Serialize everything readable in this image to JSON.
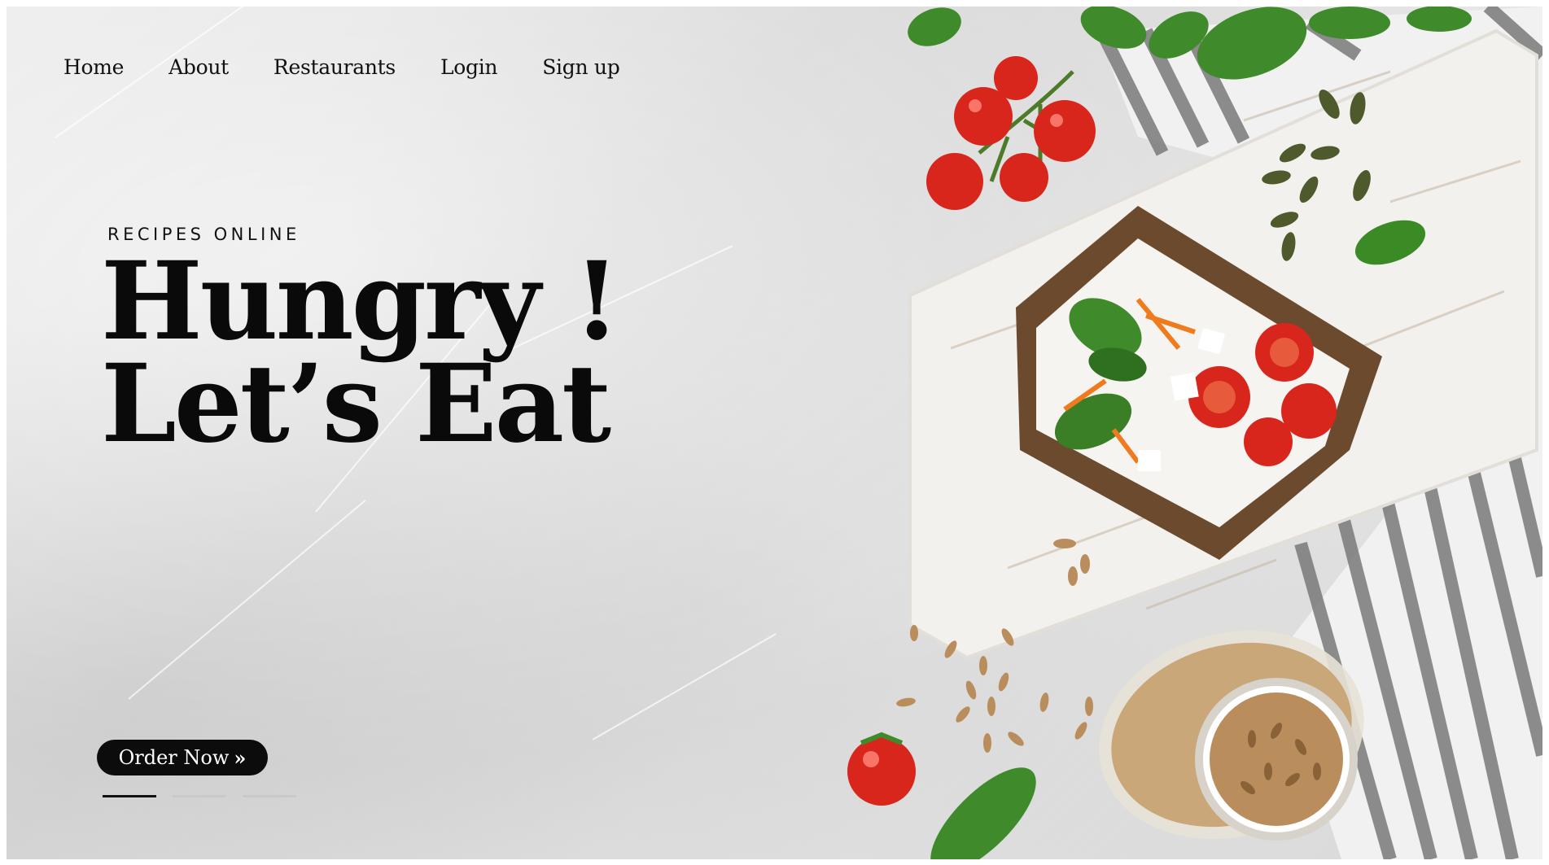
{
  "nav": {
    "items": [
      {
        "label": "Home"
      },
      {
        "label": "About"
      },
      {
        "label": "Restaurants"
      },
      {
        "label": "Login"
      },
      {
        "label": "Sign up"
      }
    ]
  },
  "hero": {
    "eyebrow": "RECIPES ONLINE",
    "headline_line1": "Hungry !",
    "headline_line2": "Let’s Eat",
    "cta_label": "Order Now",
    "cta_icon": "double-chevron-right-icon",
    "slider_count": 3,
    "slider_active_index": 0
  },
  "colors": {
    "background": "#e2e2e2",
    "text": "#0a0a0a",
    "button_bg": "#0c0c0c",
    "button_text": "#ffffff",
    "tomato": "#d9261c",
    "basil": "#3f8a2a",
    "bread": "#6b4a2e"
  }
}
